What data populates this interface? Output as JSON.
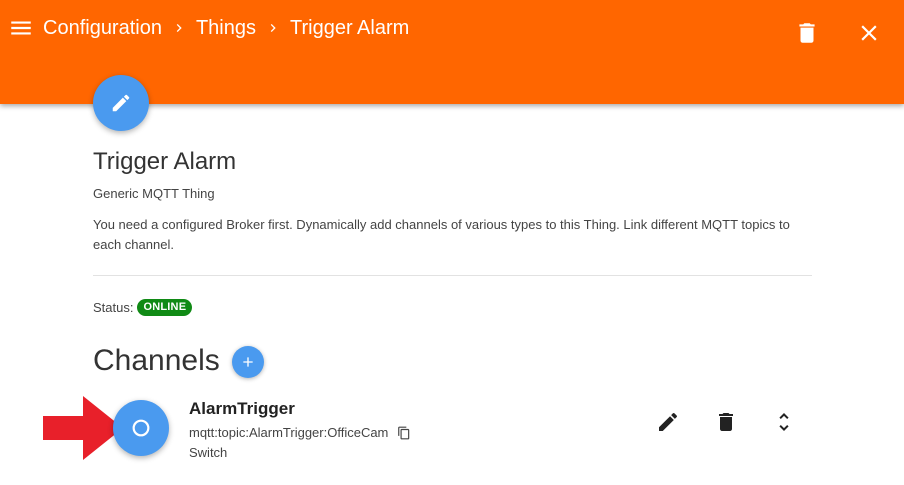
{
  "header": {
    "breadcrumbs": [
      "Configuration",
      "Things",
      "Trigger Alarm"
    ],
    "icons": {
      "menu": "menu-icon",
      "separator": "chevron-right-icon",
      "delete": "trash-icon",
      "close": "close-icon"
    }
  },
  "colors": {
    "header_bg": "#ff6600",
    "accent_blue": "#4a9aef",
    "online_green": "#108a15",
    "arrow_red": "#e8202a"
  },
  "thing": {
    "edit_icon": "pencil-icon",
    "title": "Trigger Alarm",
    "type": "Generic MQTT Thing",
    "description": "You need a configured Broker first. Dynamically add channels of various types to this Thing. Link different MQTT topics to each channel.",
    "status_label": "Status:",
    "status_value": "ONLINE"
  },
  "channels": {
    "heading": "Channels",
    "add_icon": "plus-icon",
    "items": [
      {
        "name": "AlarmTrigger",
        "uid": "mqtt:topic:AlarmTrigger:OfficeCam",
        "kind": "Switch",
        "icons": {
          "avatar": "circle-outline-icon",
          "copy": "copy-icon",
          "edit": "pencil-icon",
          "delete": "trash-icon",
          "expand": "unfold-icon"
        }
      }
    ]
  },
  "annotation": {
    "pointer": "red-arrow-icon"
  }
}
